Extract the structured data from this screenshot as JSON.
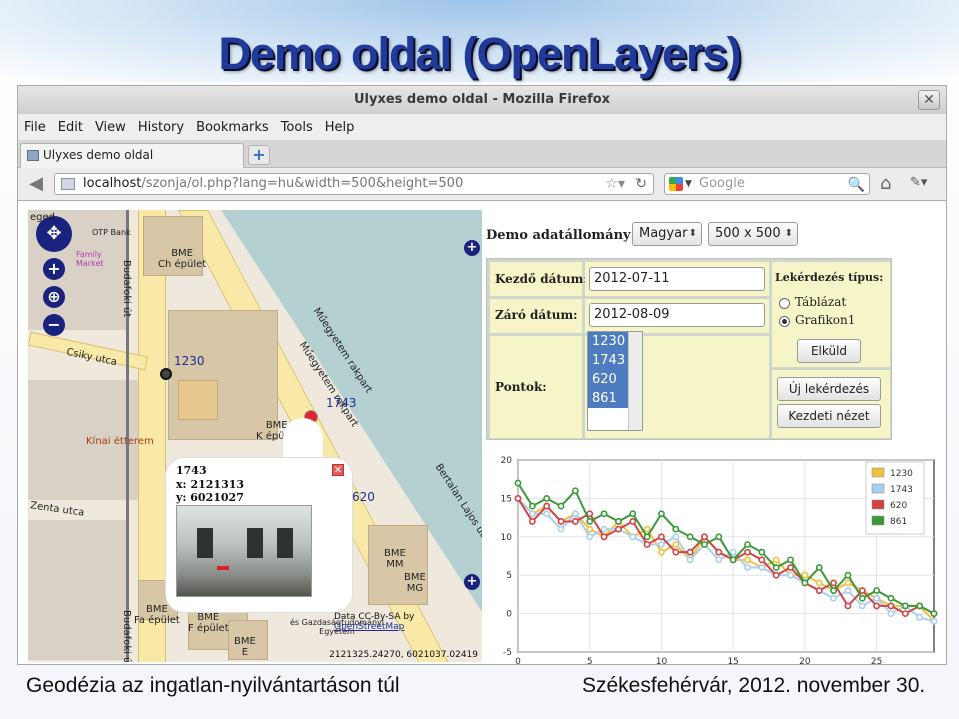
{
  "slide": {
    "title": "Demo oldal (OpenLayers)",
    "footer_left": "Geodézia az ingatlan-nyilvántartáson  túl",
    "footer_right": "Székesfehérvár, 2012. november 30."
  },
  "browser": {
    "window_title": "Ulyxes demo oldal - Mozilla Firefox",
    "menu": [
      "File",
      "Edit",
      "View",
      "History",
      "Bookmarks",
      "Tools",
      "Help"
    ],
    "tab_title": "Ulyxes demo oldal",
    "url_host": "localhost",
    "url_rest": "/szonja/ol.php?lang=hu&width=500&height=500",
    "search_placeholder": "Google"
  },
  "map": {
    "labels": {
      "top_left": "eged",
      "otp": "OTP Bank",
      "bme_ch": "BME\nCh épület",
      "bme_k": "BME\nK épület",
      "bme_mm": "BME\nMM",
      "bme_mg": "BME\nMG",
      "bme_fa": "BME\nFa épület",
      "bme_f": "BME\nF épület",
      "bme_e": "BME\nE",
      "kinai": "Kínai étterem",
      "csiky": "Csiky utca",
      "zenta": "Zenta utca",
      "budafoki": "Budafoki út",
      "budafoki2": "Budafoki út",
      "muegyetem1": "Műegyetem rakpart",
      "muegyetem2": "Műegyetem rakpart",
      "bertalan": "Bertalan Lajos utca",
      "es_gazd": "és Gazdaságtudományi\nEgyetem",
      "family": "Family\nMarket"
    },
    "stations": [
      {
        "id": "1230",
        "label": "1230"
      },
      {
        "id": "1743",
        "label": "1743"
      },
      {
        "id": "620",
        "label": "620"
      }
    ],
    "popup": {
      "title": "1743",
      "x_line": "x: 2121313",
      "y_line": "y: 6021027"
    },
    "attribution_prefix": "Data CC-By-SA by ",
    "attribution_link": "OpenStreetMap",
    "coords": "2121325.24270, 6021037.02419"
  },
  "panel": {
    "dataset_label": "Demo adatállomány",
    "language_select": "Magyar",
    "size_select": "500 x 500",
    "start_label": "Kezdő dátum:",
    "start_value": "2012-07-11",
    "end_label": "Záró dátum:",
    "end_value": "2012-08-09",
    "points_label": "Pontok:",
    "points": [
      "1230",
      "1743",
      "620",
      "861"
    ],
    "query_type_label": "Lekérdezés típus:",
    "radio_table": "Táblázat",
    "radio_chart": "Grafikon1",
    "send_button": "Elküld",
    "new_query_button": "Új lekérdezés",
    "start_view_button": "Kezdeti nézet"
  },
  "chart_data": {
    "type": "line",
    "xlim": [
      0,
      29
    ],
    "ylim": [
      -5,
      20
    ],
    "x_ticks": [
      0,
      5,
      10,
      15,
      20,
      25
    ],
    "y_ticks": [
      -5,
      0,
      5,
      10,
      15,
      20
    ],
    "grid": true,
    "legend_position": "top-right",
    "series": [
      {
        "name": "1230",
        "color": "#f0c040",
        "values": [
          15,
          13,
          14,
          12,
          13,
          11,
          10,
          12,
          10,
          11,
          8,
          9,
          7,
          10,
          8,
          7,
          7,
          6,
          7,
          5,
          5,
          4,
          3,
          4,
          3,
          2,
          1,
          1,
          1,
          -1
        ]
      },
      {
        "name": "1743",
        "color": "#a9cfee",
        "values": [
          15,
          13,
          13,
          11,
          13,
          10,
          11,
          11,
          10,
          9,
          9,
          10,
          7,
          9,
          7,
          8,
          6,
          6,
          5,
          5,
          4,
          3,
          2,
          3,
          1,
          2,
          0,
          1,
          -0.5,
          -1
        ]
      },
      {
        "name": "620",
        "color": "#d04545",
        "values": [
          15,
          12,
          14,
          12,
          12,
          13,
          10,
          11,
          12,
          9,
          10,
          8,
          8,
          10,
          8,
          7,
          8,
          7,
          5,
          6,
          4,
          3,
          4,
          1,
          3,
          1,
          1,
          0,
          1,
          0
        ]
      },
      {
        "name": "861",
        "color": "#3a9a3a",
        "values": [
          17,
          14,
          15,
          14,
          16,
          12,
          13,
          12,
          13,
          10,
          13,
          11,
          10,
          9,
          10,
          7,
          9,
          8,
          6,
          7,
          4,
          6,
          3,
          5,
          2,
          3,
          2,
          1,
          1,
          0
        ]
      }
    ]
  },
  "colors": {
    "title": "#1f3a9a",
    "map_control": "#19237d",
    "list_selection": "#4e7cc1",
    "form_cell": "#f5f5c8"
  }
}
